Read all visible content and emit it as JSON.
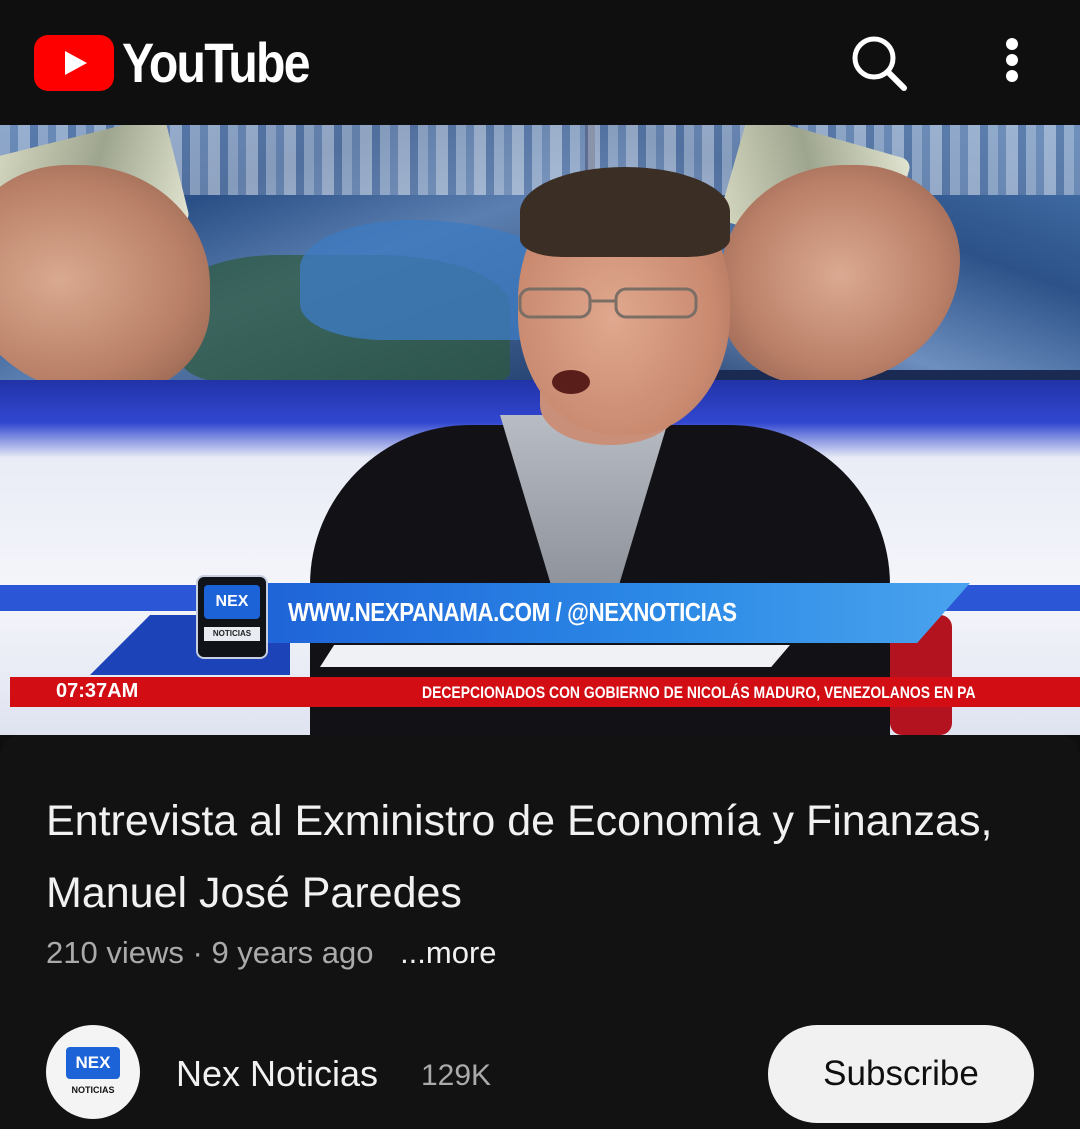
{
  "header": {
    "app_name": "YouTube",
    "icons": [
      "youtube-logo-icon",
      "search-icon",
      "more-vert-icon"
    ]
  },
  "video": {
    "overlay": {
      "url_text": "WWW.NEXPANAMA.COM / @NEXNOTICIAS",
      "badge_text": "NEX",
      "badge_subtext": "NOTICIAS",
      "time": "07:37AM",
      "ticker": "DECEPCIONADOS CON  GOBIERNO DE NICOLÁS MADURO, VENEZOLANOS  EN PA"
    }
  },
  "info": {
    "title": "Entrevista al Exministro de Economía y Finanzas, Manuel José Paredes",
    "views": "210 views",
    "separator": "·",
    "age": "9 years ago",
    "more_label": "...more",
    "channel": {
      "name": "Nex Noticias",
      "subscribers": "129K",
      "avatar_text": "NEX",
      "avatar_subtext": "NOTICIAS"
    },
    "subscribe_label": "Subscribe"
  },
  "colors": {
    "background": "#0f0f0f",
    "brand_red": "#ff0000",
    "ticker_red": "#d20d14",
    "accent_blue": "#1c63d8"
  }
}
